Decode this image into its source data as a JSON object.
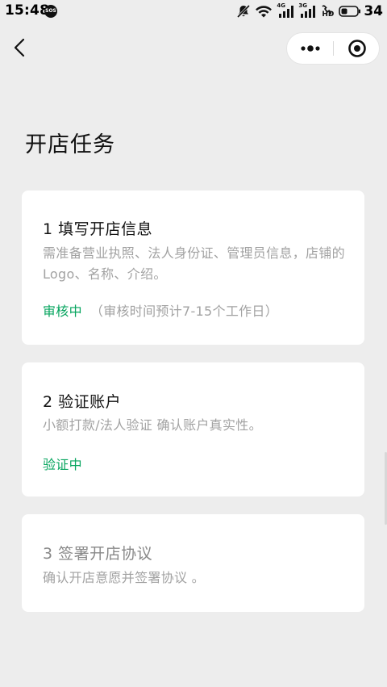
{
  "status_bar": {
    "time": "15:48",
    "sos_label": "SOS",
    "network_4g": "4G",
    "network_3g": "3G",
    "hd_label": "HD",
    "battery_level": "34"
  },
  "page": {
    "title": "开店任务"
  },
  "tasks": [
    {
      "title": "1 填写开店信息",
      "description": "需准备营业执照、法人身份证、管理员信息，店铺的Logo、名称、介绍。",
      "status": "审核中",
      "note": "（审核时间预计7-15个工作日）"
    },
    {
      "title": "2 验证账户",
      "description": "小额打款/法人验证 确认账户真实性。",
      "status": "验证中"
    },
    {
      "title": "3 签署开店协议",
      "description": "确认开店意愿并签署协议 。"
    }
  ],
  "colors": {
    "background": "#ededed",
    "card": "#ffffff",
    "accent_green": "#07a55f",
    "secondary_text": "#a2a2a2"
  },
  "icons": {
    "back": "chevron-left-icon",
    "more": "more-dots-icon",
    "close": "target-circle-icon",
    "mute": "bell-slash-icon",
    "wifi": "wifi-icon",
    "battery": "battery-icon"
  }
}
